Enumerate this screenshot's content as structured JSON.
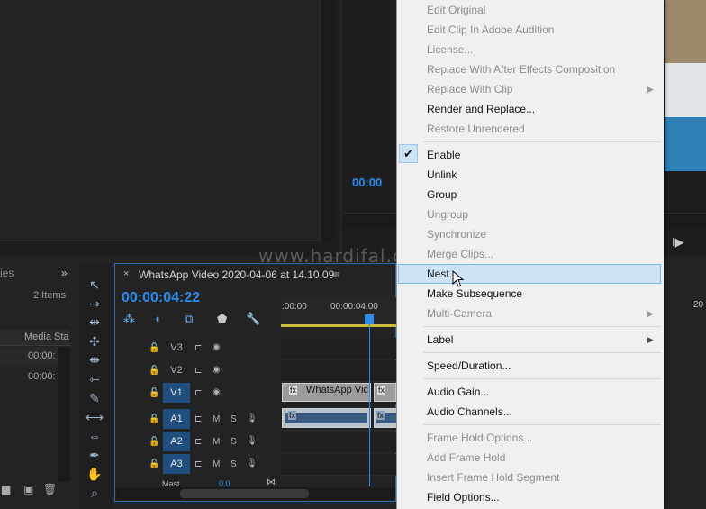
{
  "program": {
    "timecode": "00:00",
    "controls": "I▶"
  },
  "project": {
    "more": "»",
    "items_count": "2 Items",
    "column_header": "Media Sta",
    "rows": [
      "00:00:",
      "00:00:"
    ]
  },
  "timeline": {
    "close": "×",
    "title": "WhatsApp Video 2020-04-06 at 14.10.09",
    "menu": "≡",
    "timecode": "00:00:04:22",
    "ruler": [
      ":00:00",
      "00:00:04:00",
      "20"
    ],
    "tracks": [
      {
        "name": "V3",
        "active": false
      },
      {
        "name": "V2",
        "active": false
      },
      {
        "name": "V1",
        "active": true
      },
      {
        "name": "A1",
        "active": true
      },
      {
        "name": "A2",
        "active": true
      },
      {
        "name": "A3",
        "active": true
      }
    ],
    "clip_label": "WhatsApp Vic",
    "fx": "fx",
    "master": "Mast",
    "master_val": "0.0"
  },
  "watermark": "www.hardifal.com",
  "context_menu": {
    "items": [
      {
        "label": "Edit Original",
        "enabled": false
      },
      {
        "label": "Edit Clip In Adobe Audition",
        "enabled": false
      },
      {
        "label": "License...",
        "enabled": false
      },
      {
        "label": "Replace With After Effects Composition",
        "enabled": false
      },
      {
        "label": "Replace With Clip",
        "enabled": false,
        "submenu": true
      },
      {
        "label": "Render and Replace...",
        "enabled": true
      },
      {
        "label": "Restore Unrendered",
        "enabled": false
      },
      {
        "label": "Enable",
        "enabled": true,
        "checked": true
      },
      {
        "label": "Unlink",
        "enabled": true
      },
      {
        "label": "Group",
        "enabled": true
      },
      {
        "label": "Ungroup",
        "enabled": false
      },
      {
        "label": "Synchronize",
        "enabled": false
      },
      {
        "label": "Merge Clips...",
        "enabled": false
      },
      {
        "label": "Nest...",
        "enabled": true,
        "highlighted": true
      },
      {
        "label": "Make Subsequence",
        "enabled": true
      },
      {
        "label": "Multi-Camera",
        "enabled": false,
        "submenu": true
      },
      {
        "label": "Label",
        "enabled": true,
        "submenu": true
      },
      {
        "label": "Speed/Duration...",
        "enabled": true
      },
      {
        "label": "Audio Gain...",
        "enabled": true
      },
      {
        "label": "Audio Channels...",
        "enabled": true
      },
      {
        "label": "Frame Hold Options...",
        "enabled": false
      },
      {
        "label": "Add Frame Hold",
        "enabled": false
      },
      {
        "label": "Insert Frame Hold Segment",
        "enabled": false
      },
      {
        "label": "Field Options...",
        "enabled": true
      }
    ],
    "check_mark": "✔",
    "submenu_arrow": "▶"
  },
  "colors": {
    "accent": "#2d8ceb",
    "menu_highlight": "#cde4f7"
  }
}
